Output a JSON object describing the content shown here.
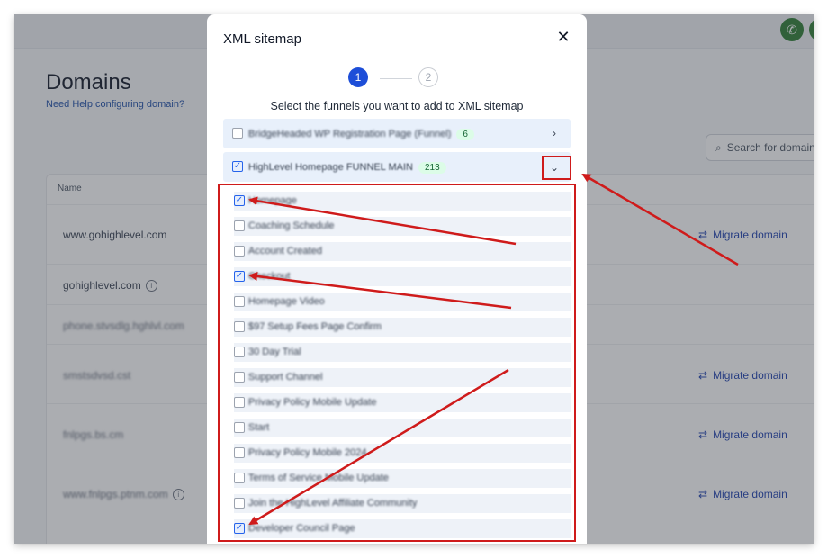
{
  "background": {
    "title": "Domains",
    "help_link": "Need Help configuring domain?",
    "search_placeholder": "Search for domain",
    "column_name": "Name",
    "rows": [
      {
        "domain": "www.gohighlevel.com",
        "info": false,
        "migrate": "Migrate domain"
      },
      {
        "domain": "gohighlevel.com",
        "info": true,
        "migrate": ""
      },
      {
        "domain": "phone.stvsdlg.hghlvl.com",
        "info": false,
        "migrate": ""
      },
      {
        "domain": "smstsdvsd.cst",
        "info": false,
        "migrate": "Migrate domain"
      },
      {
        "domain": "fnlpgs.bs.cm",
        "info": false,
        "migrate": "Migrate domain"
      },
      {
        "domain": "www.fnlpgs.ptnm.com",
        "info": true,
        "migrate": "Migrate domain"
      }
    ]
  },
  "modal": {
    "title": "XML sitemap",
    "steps": [
      "1",
      "2"
    ],
    "instruction": "Select the funnels you want to add to XML sitemap",
    "funnels": [
      {
        "label": "BridgeHeaded WP Registration Page (Funnel)",
        "count": "6",
        "checked": false,
        "expanded": false
      },
      {
        "label": "HighLevel Homepage FUNNEL MAIN",
        "count": "213",
        "checked": true,
        "expanded": true
      }
    ],
    "pages": [
      {
        "label": "Homepage",
        "checked": true
      },
      {
        "label": "Coaching Schedule",
        "checked": false
      },
      {
        "label": "Account Created",
        "checked": false
      },
      {
        "label": "Checkout",
        "checked": true
      },
      {
        "label": "Homepage Video",
        "checked": false
      },
      {
        "label": "$97 Setup Fees Page Confirm",
        "checked": false
      },
      {
        "label": "30 Day Trial",
        "checked": false
      },
      {
        "label": "Support Channel",
        "checked": false
      },
      {
        "label": "Privacy Policy Mobile Update",
        "checked": false
      },
      {
        "label": "Start",
        "checked": false
      },
      {
        "label": "Privacy Policy Mobile 2024",
        "checked": false
      },
      {
        "label": "Terms of Service Mobile Update",
        "checked": false
      },
      {
        "label": "Join the HighLevel Affiliate Community",
        "checked": false
      },
      {
        "label": "Developer Council Page",
        "checked": true
      }
    ]
  },
  "colors": {
    "accent": "#1d4ed8",
    "annotation_red": "#cf1b1b",
    "badge_green": "#dcfce7",
    "row_highlight": "#e8f0fb"
  }
}
